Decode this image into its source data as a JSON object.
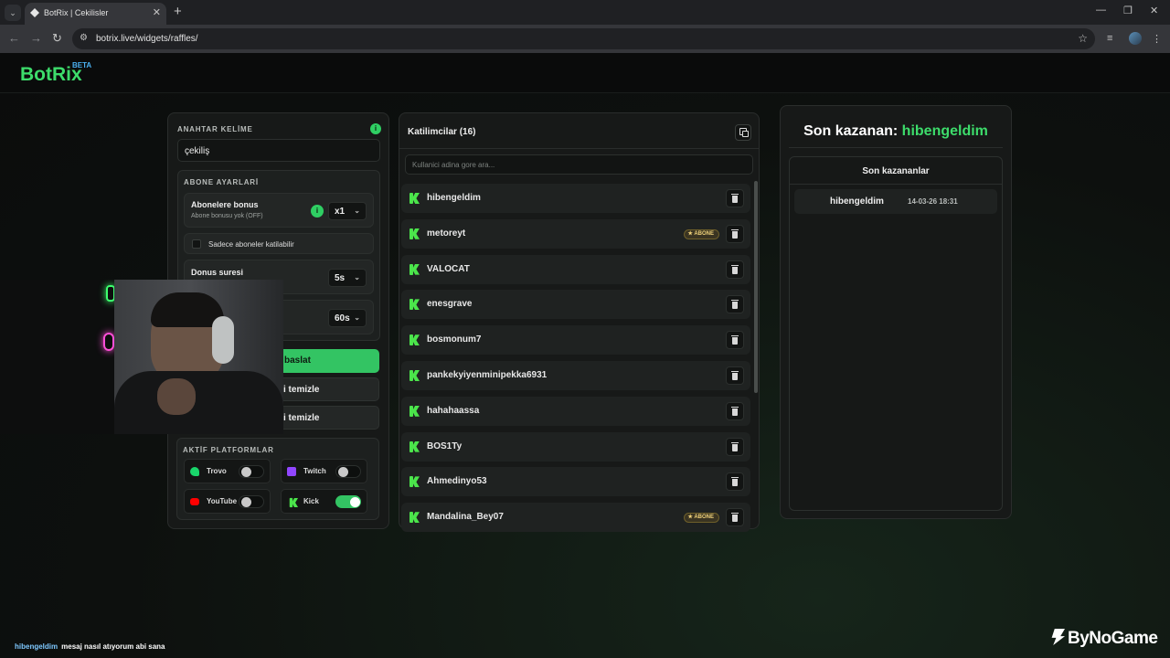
{
  "browser": {
    "tab_title": "BotRix | Cekilisler",
    "url": "botrix.live/widgets/raffles/"
  },
  "site": {
    "logo": "BotRix",
    "beta": "BETA"
  },
  "settings": {
    "keyword_label": "ANAHTAR KELİME",
    "keyword_value": "çekiliş",
    "sub_settings_label": "ABONE AYARLARİ",
    "sub_bonus_title": "Abonelere bonus",
    "sub_bonus_desc": "Abone bonusu yok (OFF)",
    "sub_bonus_value": "x1",
    "sub_only_label": "Sadece aboneler katilabilir",
    "bonus_duration_title": "Donus suresi",
    "bonus_duration_value": "5s",
    "timer_value": "60s",
    "start_button": "baslat",
    "clear_button_1": "i temizle",
    "clear_button_2": "i temizle",
    "platforms_label": "AKTİF PLATFORMLAR",
    "platforms": [
      {
        "name": "Trovo",
        "enabled": false,
        "color": "#19d66b"
      },
      {
        "name": "Twitch",
        "enabled": false,
        "color": "#9146ff"
      },
      {
        "name": "YouTube",
        "enabled": false,
        "color": "#ff0000"
      },
      {
        "name": "Kick",
        "enabled": true,
        "color": "#53fc18"
      }
    ]
  },
  "participants": {
    "title": "Katilimcilar (16)",
    "search_placeholder": "Kullanici adina gore ara...",
    "subscriber_badge": "★ ABONE",
    "list": [
      {
        "name": "hibengeldim",
        "subscriber": false
      },
      {
        "name": "metoreyt",
        "subscriber": true
      },
      {
        "name": "VALOCAT",
        "subscriber": false
      },
      {
        "name": "enesgrave",
        "subscriber": false
      },
      {
        "name": "bosmonum7",
        "subscriber": false
      },
      {
        "name": "pankekyiyenminipekka6931",
        "subscriber": false
      },
      {
        "name": "hahahaassa",
        "subscriber": false
      },
      {
        "name": "BOS1Ty",
        "subscriber": false
      },
      {
        "name": "Ahmedinyo53",
        "subscriber": false
      },
      {
        "name": "Mandalina_Bey07",
        "subscriber": true
      }
    ]
  },
  "winners": {
    "last_winner_label": "Son kazanan:",
    "last_winner_name": "hibengeldim",
    "recent_title": "Son kazananlar",
    "recent": [
      {
        "name": "hibengeldim",
        "date": "14-03-26 18:31"
      }
    ]
  },
  "overlay": {
    "chat_user": "hibengeldim",
    "chat_message": "mesaj nasıl atıyorum abi sana",
    "sponsor": "ByNoGame"
  },
  "colors": {
    "accent": "#3ddc6b",
    "kick": "#4be54b"
  }
}
